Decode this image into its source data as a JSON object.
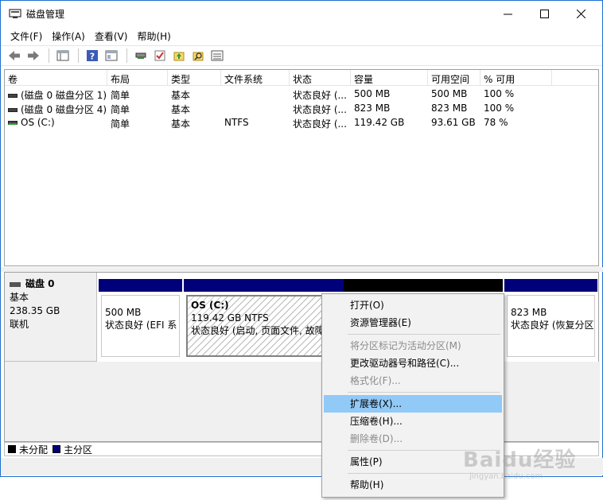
{
  "window": {
    "title": "磁盘管理",
    "minimize_icon": "minimize-icon",
    "maximize_icon": "maximize-icon",
    "close_icon": "close-icon"
  },
  "menubar": [
    {
      "label": "文件(F)"
    },
    {
      "label": "操作(A)"
    },
    {
      "label": "查看(V)"
    },
    {
      "label": "帮助(H)"
    }
  ],
  "toolbar": {
    "icons": [
      "back-arrow-icon",
      "forward-arrow-icon",
      "console-icon",
      "help-icon",
      "properties-icon",
      "connect-icon",
      "check-icon",
      "up-folder-icon",
      "search-folder-icon",
      "list-icon"
    ]
  },
  "volume_table": {
    "headers": [
      "卷",
      "布局",
      "类型",
      "文件系统",
      "状态",
      "容量",
      "可用空间",
      "% 可用"
    ],
    "rows": [
      {
        "volume": "(磁盘 0 磁盘分区 1)",
        "layout": "简单",
        "type": "基本",
        "fs": "",
        "status": "状态良好 (...",
        "capacity": "500 MB",
        "free": "500 MB",
        "pct": "100 %"
      },
      {
        "volume": "(磁盘 0 磁盘分区 4)",
        "layout": "简单",
        "type": "基本",
        "fs": "",
        "status": "状态良好 (...",
        "capacity": "823 MB",
        "free": "823 MB",
        "pct": "100 %"
      },
      {
        "volume": "OS (C:)",
        "layout": "简单",
        "type": "基本",
        "fs": "NTFS",
        "status": "状态良好 (...",
        "capacity": "119.42 GB",
        "free": "93.61 GB",
        "pct": "78 %"
      }
    ]
  },
  "disk": {
    "name": "磁盘 0",
    "type": "基本",
    "size": "238.35 GB",
    "state": "联机"
  },
  "partitions": [
    {
      "line1": "500 MB",
      "line2": "状态良好 (EFI 系"
    },
    {
      "title": "OS  (C:)",
      "line1": "119.42 GB NTFS",
      "line2": "状态良好 (启动, 页面文件, 故障转"
    },
    {
      "line1": "",
      "line2": ""
    },
    {
      "line1": "823 MB",
      "line2": "状态良好 (恢复分区"
    }
  ],
  "legend": {
    "unallocated": "未分配",
    "primary": "主分区",
    "colors": {
      "unallocated": "#000000",
      "primary": "#00007a"
    }
  },
  "context_menu": [
    {
      "label": "打开(O)",
      "disabled": false
    },
    {
      "label": "资源管理器(E)",
      "disabled": false
    },
    {
      "sep": true
    },
    {
      "label": "将分区标记为活动分区(M)",
      "disabled": true
    },
    {
      "label": "更改驱动器号和路径(C)...",
      "disabled": false
    },
    {
      "label": "格式化(F)...",
      "disabled": true
    },
    {
      "sep": true
    },
    {
      "label": "扩展卷(X)...",
      "disabled": false,
      "highlight": true
    },
    {
      "label": "压缩卷(H)...",
      "disabled": false
    },
    {
      "label": "删除卷(D)...",
      "disabled": true
    },
    {
      "sep": true
    },
    {
      "label": "属性(P)",
      "disabled": false
    },
    {
      "sep": true
    },
    {
      "label": "帮助(H)",
      "disabled": false
    }
  ],
  "watermark": {
    "brand": "Baidu经验",
    "url": "jingyan.baidu.com"
  }
}
